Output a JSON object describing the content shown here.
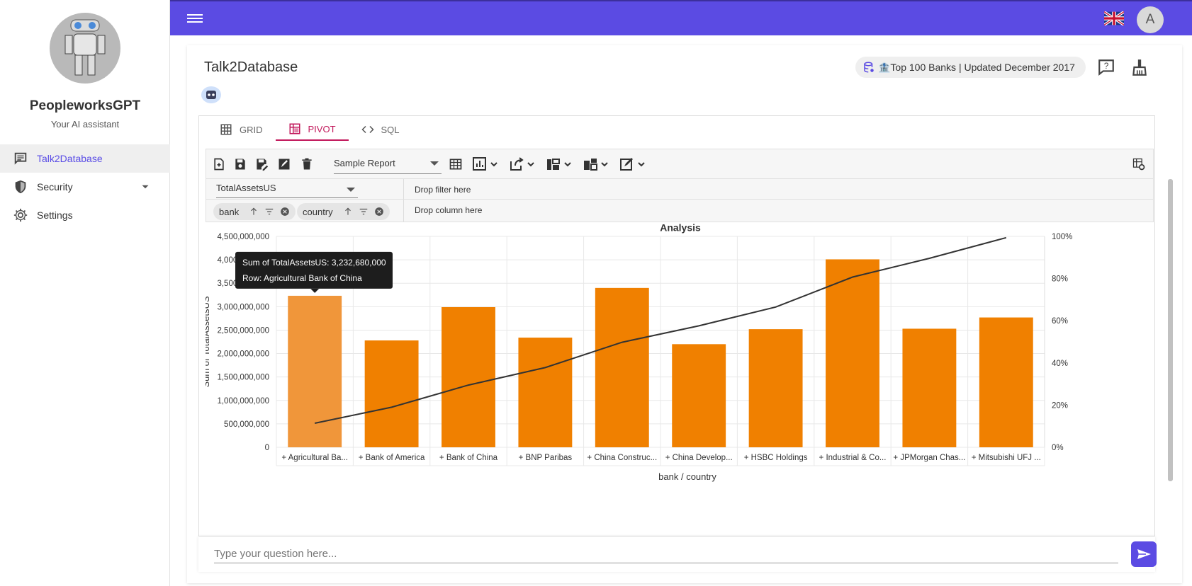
{
  "sidebar": {
    "app_name": "PeopleworksGPT",
    "app_subtitle": "Your AI assistant",
    "items": [
      {
        "label": "Talk2Database",
        "icon": "chat-icon",
        "active": true
      },
      {
        "label": "Security",
        "icon": "shield-icon",
        "active": false
      },
      {
        "label": "Settings",
        "icon": "gear-icon",
        "active": false
      }
    ]
  },
  "topbar": {
    "user_initial": "A",
    "accent": "#5b4be3"
  },
  "page": {
    "title": "Talk2Database",
    "datasource": "🏦Top 100 Banks | Updated December 2017"
  },
  "tabs": [
    {
      "label": "GRID",
      "icon": "grid-icon"
    },
    {
      "label": "PIVOT",
      "icon": "pivot-icon",
      "active": true
    },
    {
      "label": "SQL",
      "icon": "code-icon"
    }
  ],
  "pivot": {
    "report_name": "Sample Report",
    "measure": "TotalAssetsUS",
    "drop_filter": "Drop filter here",
    "drop_column": "Drop column here",
    "row_fields": [
      "bank",
      "country"
    ]
  },
  "chart_data": {
    "type": "bar",
    "title": "Analysis",
    "xlabel": "bank / country",
    "ylabel": "Sum of TotalAssetsUS",
    "ylim": [
      0,
      4500000000
    ],
    "y_ticks": [
      "4,500,000,000",
      "4,000,000,000",
      "3,500,000,000",
      "3,000,000,000",
      "2,500,000,000",
      "2,000,000,000",
      "1,500,000,000",
      "1,000,000,000",
      "500,000,000",
      "0"
    ],
    "y2_ticks": [
      "100%",
      "80%",
      "60%",
      "40%",
      "20%",
      "0%"
    ],
    "categories": [
      "+ Agricultural Ba...",
      "+ Bank of America",
      "+ Bank of China",
      "+ BNP Paribas",
      "+ China Construc...",
      "+ China Develop...",
      "+ HSBC Holdings",
      "+ Industrial & Co...",
      "+ JPMorgan Chas...",
      "+ Mitsubishi UFJ ..."
    ],
    "series": [
      {
        "type": "bar",
        "color": "#f08000",
        "values": [
          3232680000,
          2280000000,
          2990000000,
          2340000000,
          3400000000,
          2200000000,
          2520000000,
          4010000000,
          2530000000,
          2770000000
        ]
      },
      {
        "type": "line",
        "color": "#333333",
        "values": [
          11.4,
          19.0,
          29.5,
          37.8,
          49.8,
          57.6,
          66.5,
          80.7,
          89.6,
          99.4
        ]
      }
    ],
    "tooltip": {
      "line1": "Sum of TotalAssetsUS: 3,232,680,000",
      "line2": "Row: Agricultural Bank of China"
    }
  },
  "input": {
    "placeholder": "Type your question here..."
  }
}
